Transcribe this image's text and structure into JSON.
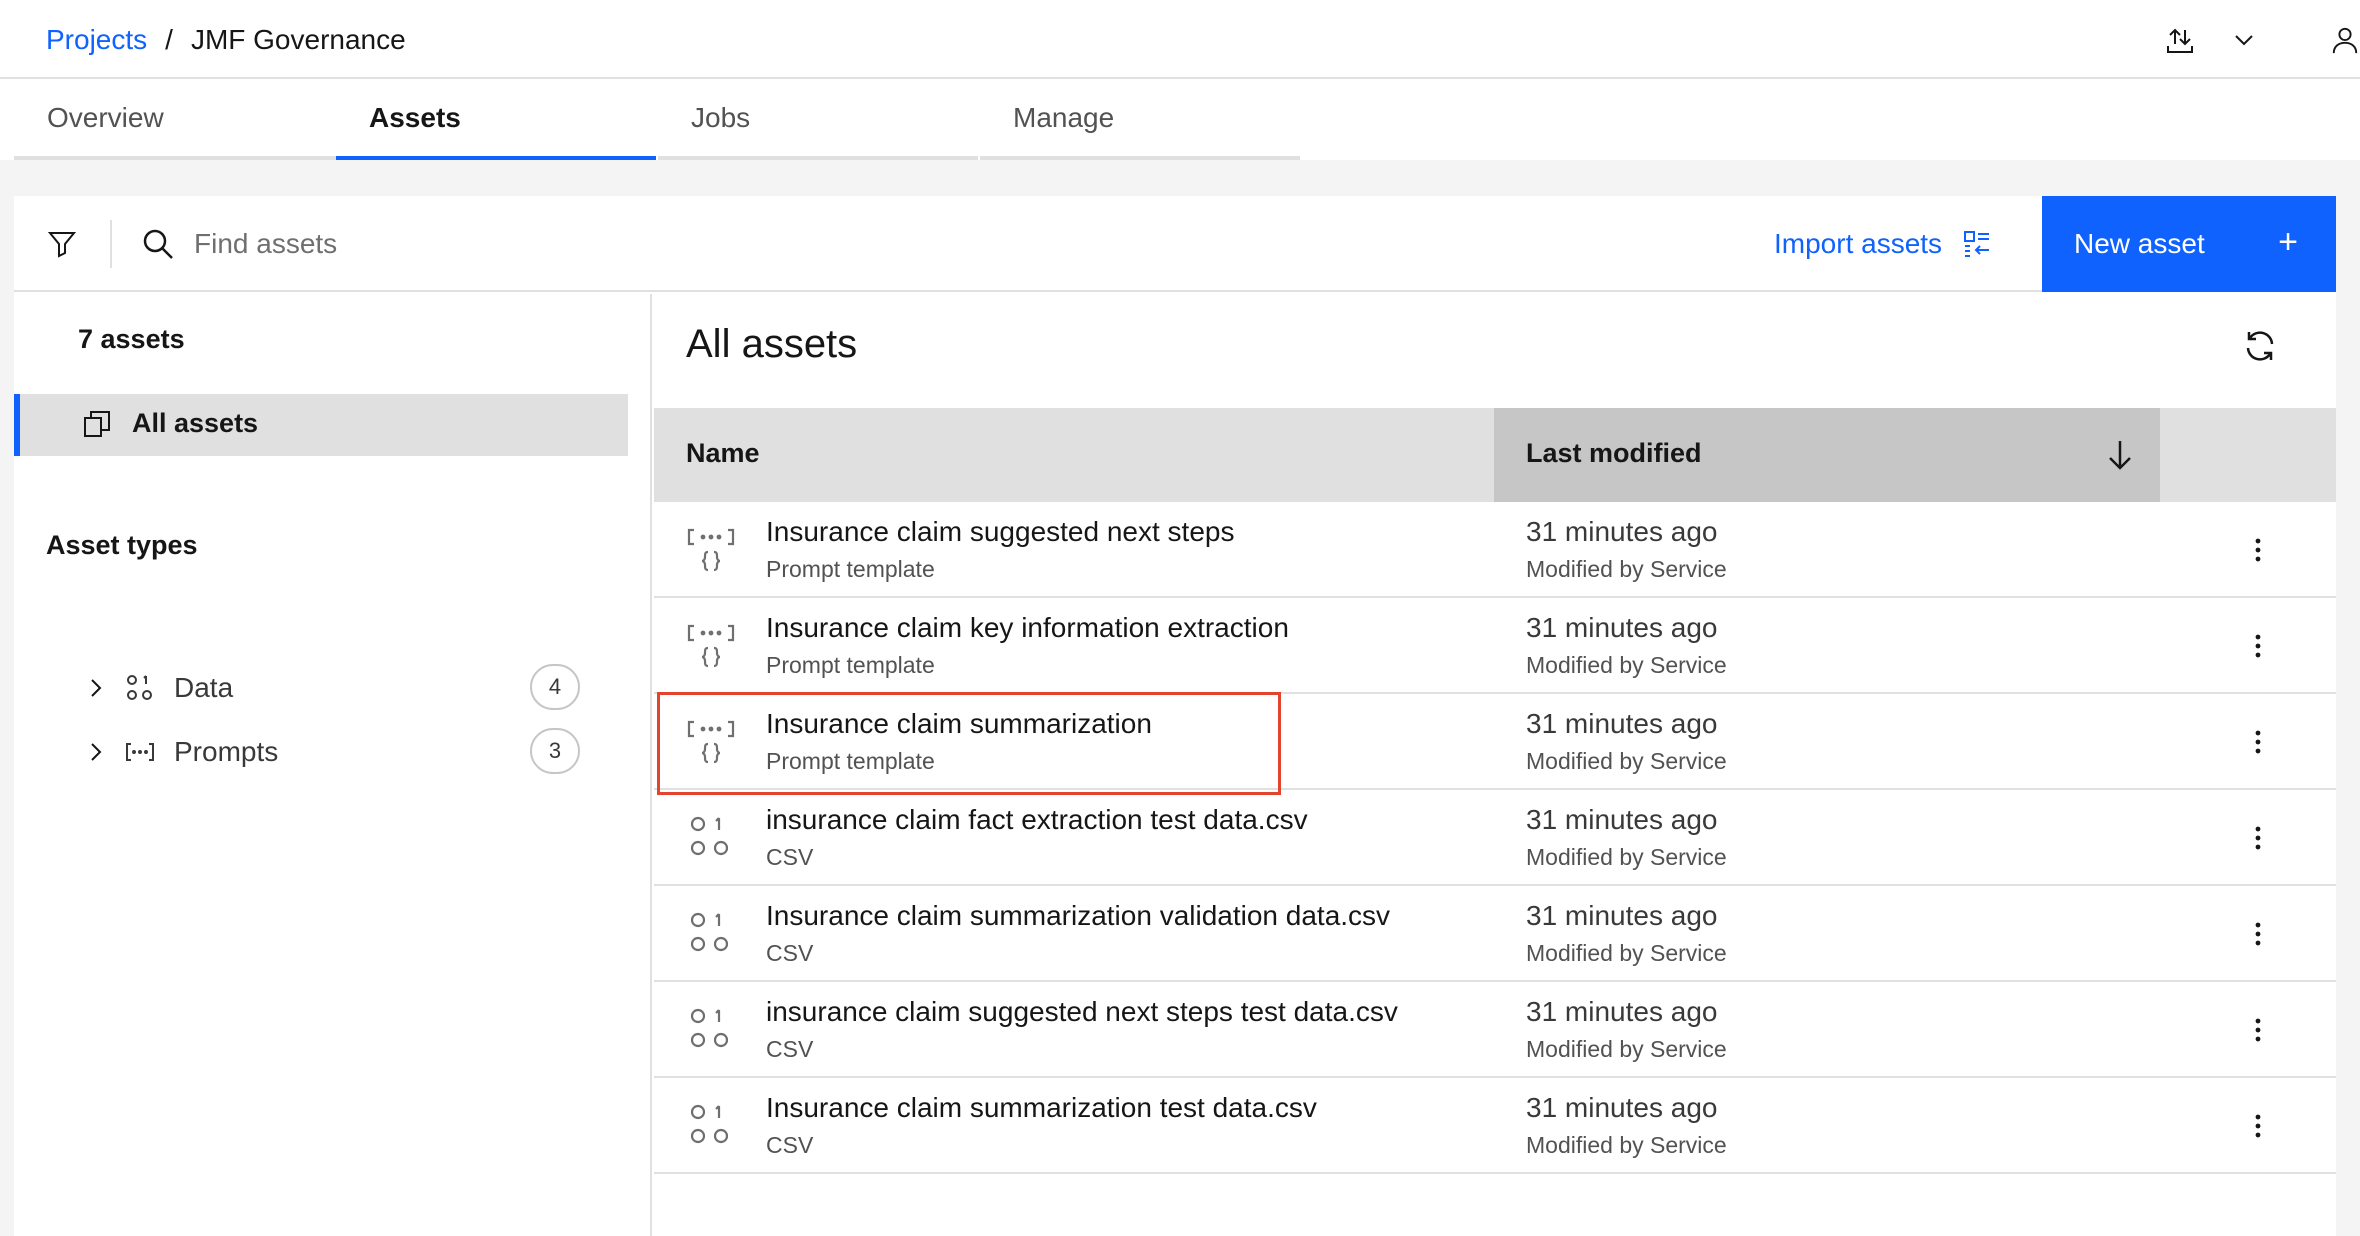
{
  "header": {
    "breadcrumb": {
      "link": "Projects",
      "separator": "/",
      "current": "JMF Governance"
    }
  },
  "tabs": [
    {
      "label": "Overview"
    },
    {
      "label": "Assets"
    },
    {
      "label": "Jobs"
    },
    {
      "label": "Manage"
    }
  ],
  "toolbar": {
    "search_placeholder": "Find assets",
    "import_label": "Import assets",
    "new_asset_label": "New asset",
    "new_asset_icon": "+"
  },
  "sidebar": {
    "asset_count": "7 assets",
    "all_assets_label": "All assets",
    "asset_types_title": "Asset types",
    "types": [
      {
        "label": "Data",
        "count": "4",
        "icon": "data-icon"
      },
      {
        "label": "Prompts",
        "count": "3",
        "icon": "prompt-icon"
      }
    ]
  },
  "main": {
    "title": "All assets",
    "columns": {
      "name": "Name",
      "last_modified": "Last modified"
    },
    "rows": [
      {
        "name": "Insurance claim suggested next steps",
        "type": "Prompt template",
        "modified": "31 minutes ago",
        "modified_by": "Modified by Service",
        "icon": "prompt-template-icon"
      },
      {
        "name": "Insurance claim key information extraction",
        "type": "Prompt template",
        "modified": "31 minutes ago",
        "modified_by": "Modified by Service",
        "icon": "prompt-template-icon"
      },
      {
        "name": "Insurance claim summarization",
        "type": "Prompt template",
        "modified": "31 minutes ago",
        "modified_by": "Modified by Service",
        "icon": "prompt-template-icon"
      },
      {
        "name": "insurance claim fact extraction test data.csv",
        "type": "CSV",
        "modified": "31 minutes ago",
        "modified_by": "Modified by Service",
        "icon": "data-file-icon"
      },
      {
        "name": "Insurance claim summarization validation data.csv",
        "type": "CSV",
        "modified": "31 minutes ago",
        "modified_by": "Modified by Service",
        "icon": "data-file-icon"
      },
      {
        "name": "insurance claim suggested next steps test data.csv",
        "type": "CSV",
        "modified": "31 minutes ago",
        "modified_by": "Modified by Service",
        "icon": "data-file-icon"
      },
      {
        "name": "Insurance claim summarization test data.csv",
        "type": "CSV",
        "modified": "31 minutes ago",
        "modified_by": "Modified by Service",
        "icon": "data-file-icon"
      }
    ]
  },
  "colors": {
    "accent": "#0f62fe",
    "highlight": "#e4442e"
  }
}
